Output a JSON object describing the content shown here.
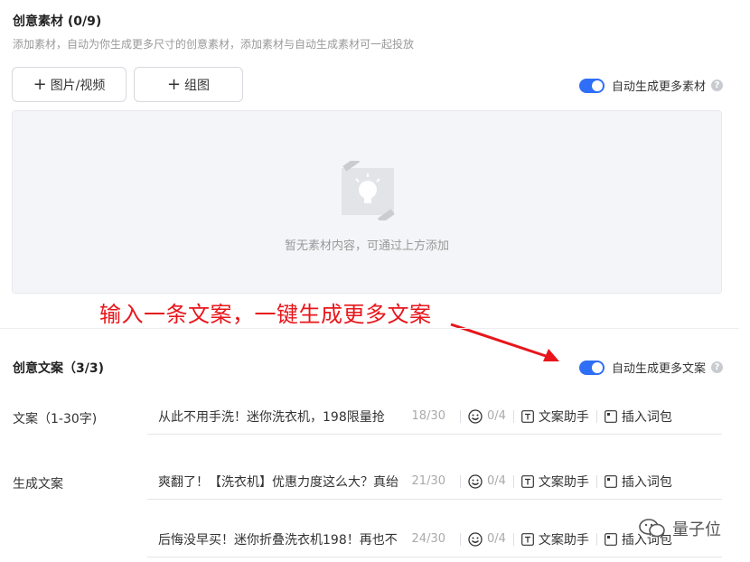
{
  "creative_material": {
    "title": "创意素材 (0/9)",
    "description": "添加素材，自动为你生成更多尺寸的创意素材，添加素材与自动生成素材可一起投放",
    "btn_image_video": "图片/视频",
    "btn_group_image": "组图",
    "plus_glyph": "+",
    "auto_toggle_label": "自动生成更多素材",
    "auto_toggle_on": true,
    "help_glyph": "?",
    "empty_text": "暂无素材内容，可通过上方添加"
  },
  "annotation": {
    "text": "输入一条文案，一键生成更多文案",
    "color": "#e8161b"
  },
  "creative_copy": {
    "title": "创意文案（3/3)",
    "auto_toggle_label": "自动生成更多文案",
    "auto_toggle_on": true,
    "help_glyph": "?",
    "input_label": "文案（1-30字)",
    "generated_label": "生成文案",
    "tool_assistant": "文案助手",
    "tool_insert": "插入词包",
    "rows": [
      {
        "text": "从此不用手洗！迷你洗衣机，198限量抢",
        "count": "18/30",
        "emoji_count": "0/4"
      },
      {
        "text": "爽翻了！【洗衣机】优惠力度这么大？真绐",
        "count": "21/30",
        "emoji_count": "0/4"
      },
      {
        "text": "后悔没早买！迷你折叠洗衣机198！再也不",
        "count": "24/30",
        "emoji_count": "0/4"
      }
    ]
  },
  "watermark": {
    "text": "量子位"
  },
  "colors": {
    "accent": "#2f6ef6",
    "annotation_red": "#e8161b"
  }
}
